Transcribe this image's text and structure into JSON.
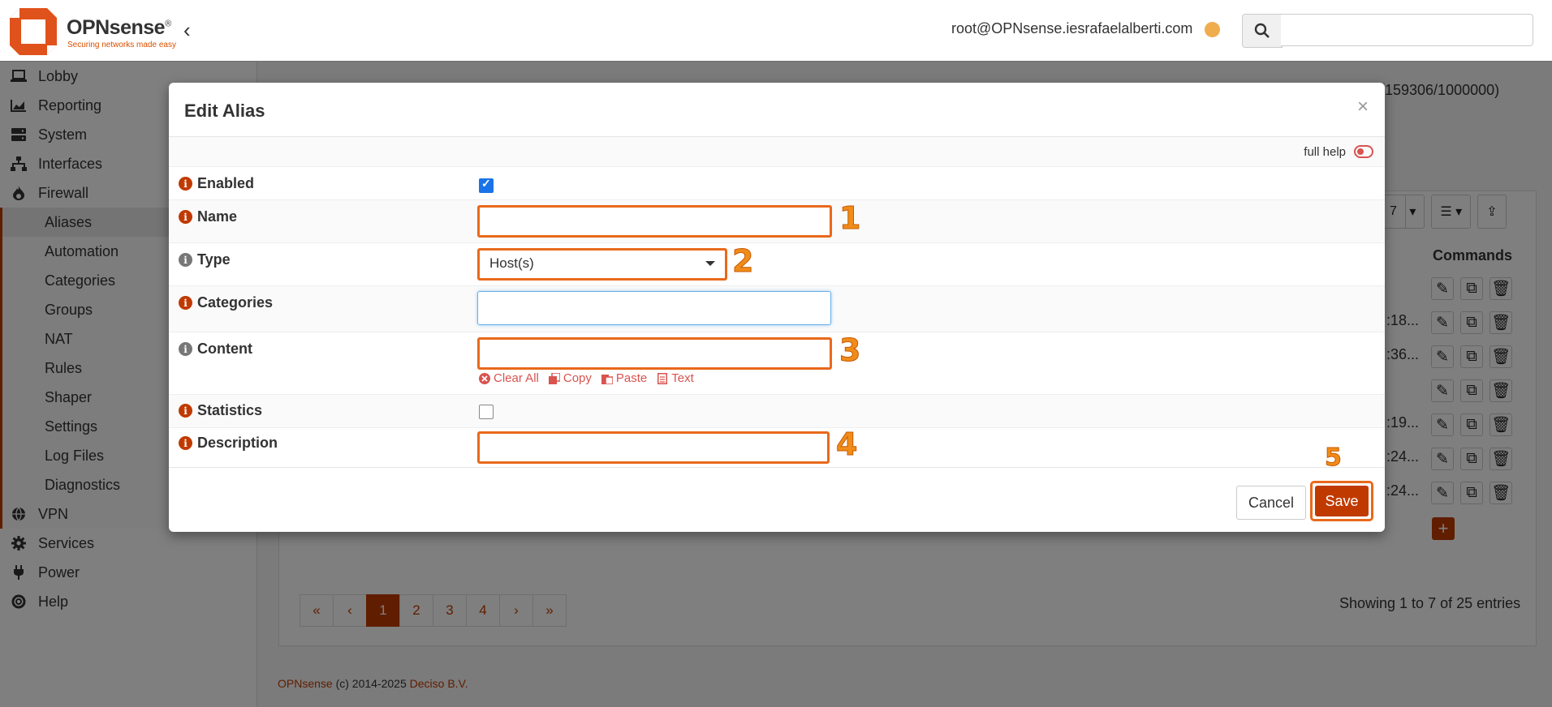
{
  "header": {
    "logo_text": "OPNsense",
    "logo_reg": "®",
    "logo_tag": "Securing networks made easy",
    "collapse_glyph": "‹",
    "user": "root@OPNsense.iesrafaelalberti.com",
    "status_color": "#f0ad4e",
    "search_placeholder": ""
  },
  "sidebar": {
    "items": [
      {
        "label": "Lobby",
        "icon": "laptop-icon"
      },
      {
        "label": "Reporting",
        "icon": "chart-area-icon"
      },
      {
        "label": "System",
        "icon": "server-icon"
      },
      {
        "label": "Interfaces",
        "icon": "sitemap-icon"
      },
      {
        "label": "Firewall",
        "icon": "fire-icon"
      }
    ],
    "firewall_sub": [
      "Aliases",
      "Automation",
      "Categories",
      "Groups",
      "NAT",
      "Rules",
      "Shaper",
      "Settings",
      "Log Files",
      "Diagnostics"
    ],
    "bottom": [
      {
        "label": "VPN",
        "icon": "globe-icon"
      },
      {
        "label": "Services",
        "icon": "cog-icon"
      },
      {
        "label": "Power",
        "icon": "plug-icon"
      },
      {
        "label": "Help",
        "icon": "life-ring-icon"
      }
    ]
  },
  "background": {
    "counter": "(159306/1000000)",
    "page_size": "7",
    "commands_header": "Commands",
    "truncated": [
      ":18...",
      ":36...",
      ":19...",
      ":24...",
      ":24..."
    ],
    "pager": [
      "«",
      "‹",
      "1",
      "2",
      "3",
      "4",
      "›",
      "»"
    ],
    "pager_active": "1",
    "showing": "Showing 1 to 7 of 25 entries",
    "footer_brand": "OPNsense",
    "footer_mid": " (c) 2014-2025 ",
    "footer_company": "Deciso B.V."
  },
  "modal": {
    "title": "Edit Alias",
    "close": "×",
    "full_help": "full help",
    "fields": {
      "enabled": {
        "label": "Enabled",
        "checked": true
      },
      "name": {
        "label": "Name",
        "value": ""
      },
      "type": {
        "label": "Type",
        "value": "Host(s)"
      },
      "categories": {
        "label": "Categories",
        "value": ""
      },
      "content": {
        "label": "Content",
        "value": ""
      },
      "statistics": {
        "label": "Statistics",
        "checked": false
      },
      "description": {
        "label": "Description",
        "value": ""
      }
    },
    "content_tools": {
      "clear": "Clear All",
      "copy": "Copy",
      "paste": "Paste",
      "text": "Text"
    },
    "annotations": [
      "1",
      "2",
      "3",
      "4",
      "5"
    ],
    "cancel": "Cancel",
    "save": "Save"
  },
  "colors": {
    "brand": "#c03a00",
    "highlight": "#e9691b",
    "annotation": "#f08c1a"
  }
}
